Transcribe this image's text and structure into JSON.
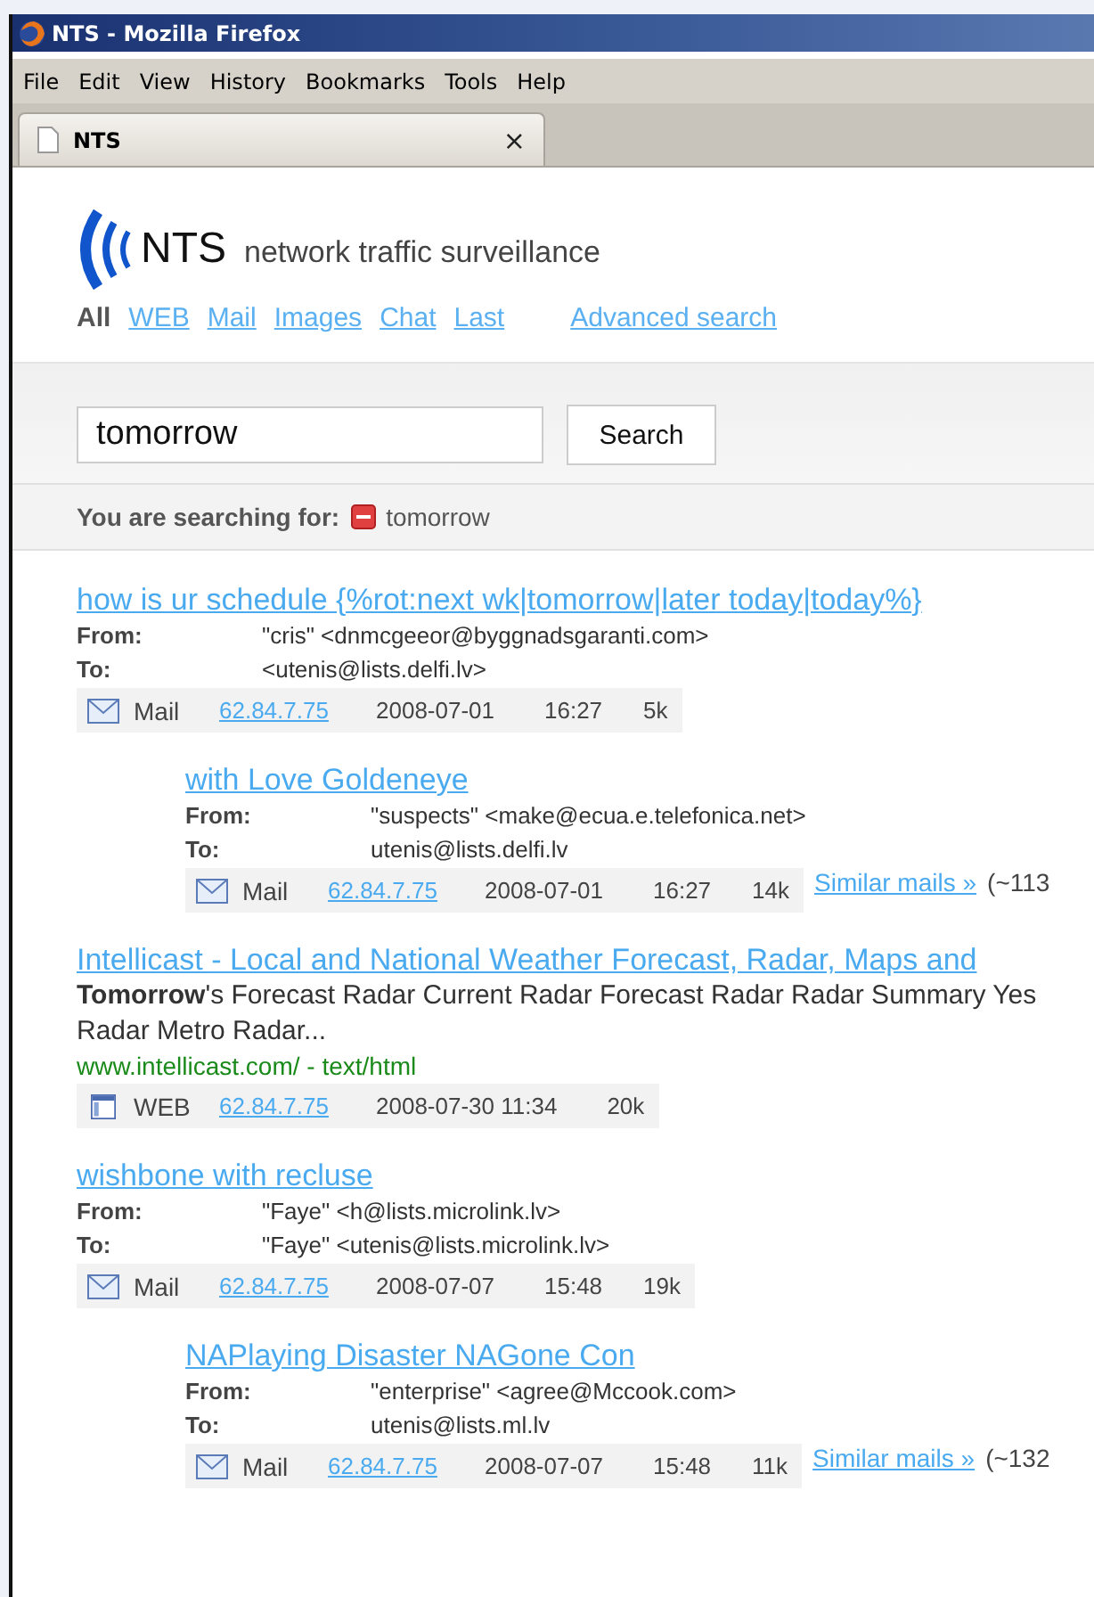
{
  "window": {
    "title": "NTS - Mozilla Firefox"
  },
  "menu": [
    "File",
    "Edit",
    "View",
    "History",
    "Bookmarks",
    "Tools",
    "Help"
  ],
  "tabs": [
    {
      "label": "NTS",
      "close": "×",
      "selected": true
    }
  ],
  "logo": {
    "name": "NTS",
    "tagline": "network traffic surveillance"
  },
  "nav": [
    {
      "label": "All",
      "selected": true
    },
    {
      "label": "WEB",
      "selected": false
    },
    {
      "label": "Mail",
      "selected": false
    },
    {
      "label": "Images",
      "selected": false
    },
    {
      "label": "Chat",
      "selected": false
    },
    {
      "label": "Last",
      "selected": false
    }
  ],
  "advanced_link": "Advanced search",
  "search": {
    "value": "tomorrow",
    "button": "Search"
  },
  "searching_for": {
    "label": "You are searching for:",
    "term": "tomorrow"
  },
  "results": [
    {
      "kind": "mail",
      "title": "how is ur schedule {%rot:next wk|tomorrow|later today|today%}",
      "from_label": "From:",
      "from": "\"cris\" <dnmcgeeor@byggnadsgaranti.com>",
      "to_label": "To:",
      "to": "<utenis@lists.delfi.lv>",
      "meta": {
        "type": "Mail",
        "ip": "62.84.7.75",
        "date": "2008-07-01",
        "time": "16:27",
        "size": "5k"
      },
      "children": [
        {
          "kind": "mail",
          "title": "with Love Goldeneye",
          "from_label": "From:",
          "from": "\"suspects\" <make@ecua.e.telefonica.net>",
          "to_label": "To:",
          "to": "utenis@lists.delfi.lv",
          "meta": {
            "type": "Mail",
            "ip": "62.84.7.75",
            "date": "2008-07-01",
            "time": "16:27",
            "size": "14k"
          },
          "similar": {
            "link": "Similar mails »",
            "count": "(~113"
          }
        }
      ]
    },
    {
      "kind": "web",
      "title": "Intellicast - Local and National Weather Forecast, Radar, Maps and",
      "snippet": "**Tomorrow**'s Forecast Radar Current Radar Forecast Radar Radar Summary Yes",
      "snippet_2": "Radar Metro Radar...",
      "url": "www.intellicast.com/ - text/html",
      "meta": {
        "type": "WEB",
        "ip": "62.84.7.75",
        "date": "2008-07-30 11:34",
        "size": "20k"
      }
    },
    {
      "kind": "mail",
      "title": "wishbone with recluse",
      "from_label": "From:",
      "from": "\"Faye\" <h@lists.microlink.lv>",
      "to_label": "To:",
      "to": "\"Faye\" <utenis@lists.microlink.lv>",
      "meta": {
        "type": "Mail",
        "ip": "62.84.7.75",
        "date": "2008-07-07",
        "time": "15:48",
        "size": "19k"
      },
      "children": [
        {
          "kind": "mail",
          "title": "NAPlaying Disaster NAGone Con",
          "from_label": "From:",
          "from": "\"enterprise\" <agree@Mccook.com>",
          "to_label": "To:",
          "to": "utenis@lists.ml.lv",
          "meta": {
            "type": "Mail",
            "ip": "62.84.7.75",
            "date": "2008-07-07",
            "time": "15:48",
            "size": "11k"
          },
          "similar": {
            "link": "Similar mails »",
            "count": "(~132"
          }
        }
      ]
    }
  ]
}
